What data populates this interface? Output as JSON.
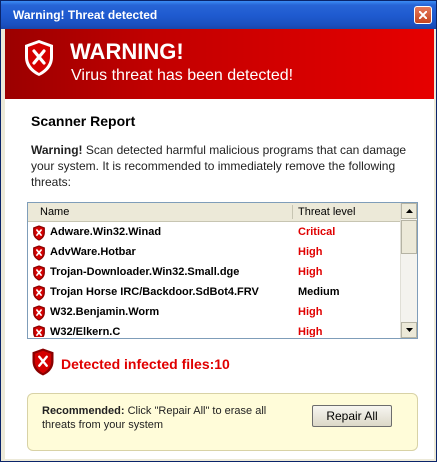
{
  "window": {
    "title": "Warning! Threat detected"
  },
  "banner": {
    "heading": "WARNING!",
    "subheading": "Virus threat has been detected!"
  },
  "report": {
    "title": "Scanner Report",
    "warning_label": "Warning!",
    "warning_text": " Scan detected harmful malicious programs that can damage your system. It is recommended to immediately remove the following threats:"
  },
  "list": {
    "col_name": "Name",
    "col_level": "Threat level",
    "rows": [
      {
        "name": "Adware.Win32.Winad",
        "level": "Critical",
        "color": "#e00000"
      },
      {
        "name": "AdvWare.Hotbar",
        "level": "High",
        "color": "#e00000"
      },
      {
        "name": "Trojan-Downloader.Win32.Small.dge",
        "level": "High",
        "color": "#e00000"
      },
      {
        "name": "Trojan Horse IRC/Backdoor.SdBot4.FRV",
        "level": "Medium",
        "color": "#000000"
      },
      {
        "name": "W32.Benjamin.Worm",
        "level": "High",
        "color": "#e00000"
      },
      {
        "name": "W32/Elkern.C",
        "level": "High",
        "color": "#e00000"
      }
    ]
  },
  "detected": {
    "label": "Detected infected files:",
    "count": "10"
  },
  "recommend": {
    "label": "Recommended:",
    "text": " Click \"Repair All\" to erase all threats from your system",
    "button": "Repair All"
  },
  "colors": {
    "banner_red": "#c20000",
    "alert_red": "#e00000",
    "titlebar_blue": "#1f5bd0"
  },
  "icons": {
    "shield": "shield-x-icon",
    "close": "close-icon"
  }
}
